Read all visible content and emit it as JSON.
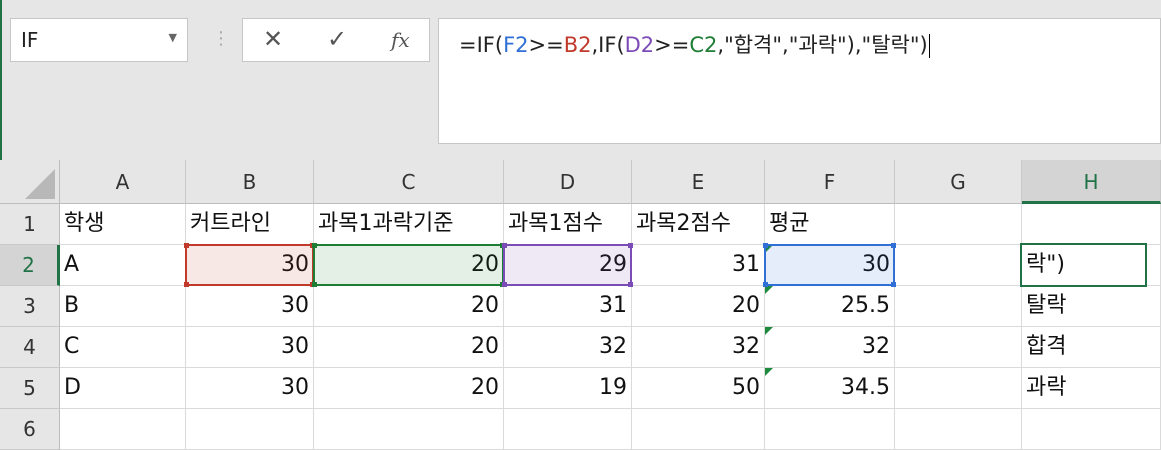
{
  "name_box": {
    "value": "IF"
  },
  "formula_bar": {
    "cancel_icon": "close-icon",
    "enter_icon": "check-icon",
    "fx_label": "fx",
    "formula_parts": [
      {
        "text": "=IF(",
        "color": "#222222"
      },
      {
        "text": "F2",
        "color": "#2f6fd6"
      },
      {
        "text": ">=",
        "color": "#222222"
      },
      {
        "text": "B2",
        "color": "#c0392b"
      },
      {
        "text": ",IF(",
        "color": "#222222"
      },
      {
        "text": "D2",
        "color": "#7b4bb6"
      },
      {
        "text": ">=",
        "color": "#222222"
      },
      {
        "text": "C2",
        "color": "#1e7d34"
      },
      {
        "text": ",\"합격\",\"과락\")",
        "color": "#222222"
      },
      {
        "text": ",\"탈락\")",
        "color": "#222222"
      }
    ]
  },
  "columns": [
    "A",
    "B",
    "C",
    "D",
    "E",
    "F",
    "G",
    "H"
  ],
  "selected_column": "H",
  "rows": [
    "1",
    "2",
    "3",
    "4",
    "5",
    "6"
  ],
  "selected_row": "2",
  "cells": [
    [
      "학생",
      "커트라인",
      "과목1과락기준",
      "과목1점수",
      "과목2점수",
      "평균",
      "",
      ""
    ],
    [
      "A",
      "30",
      "20",
      "29",
      "31",
      "30",
      "",
      "락\")"
    ],
    [
      "B",
      "30",
      "20",
      "31",
      "20",
      "25.5",
      "",
      "탈락"
    ],
    [
      "C",
      "30",
      "20",
      "32",
      "32",
      "32",
      "",
      "합격"
    ],
    [
      "D",
      "30",
      "20",
      "19",
      "50",
      "34.5",
      "",
      "과락"
    ]
  ],
  "colors": {
    "accent": "#217346",
    "ref_f2": "#2f6fd6",
    "ref_b2": "#c0392b",
    "ref_d2": "#7b4bb6",
    "ref_c2": "#1e7d34"
  }
}
